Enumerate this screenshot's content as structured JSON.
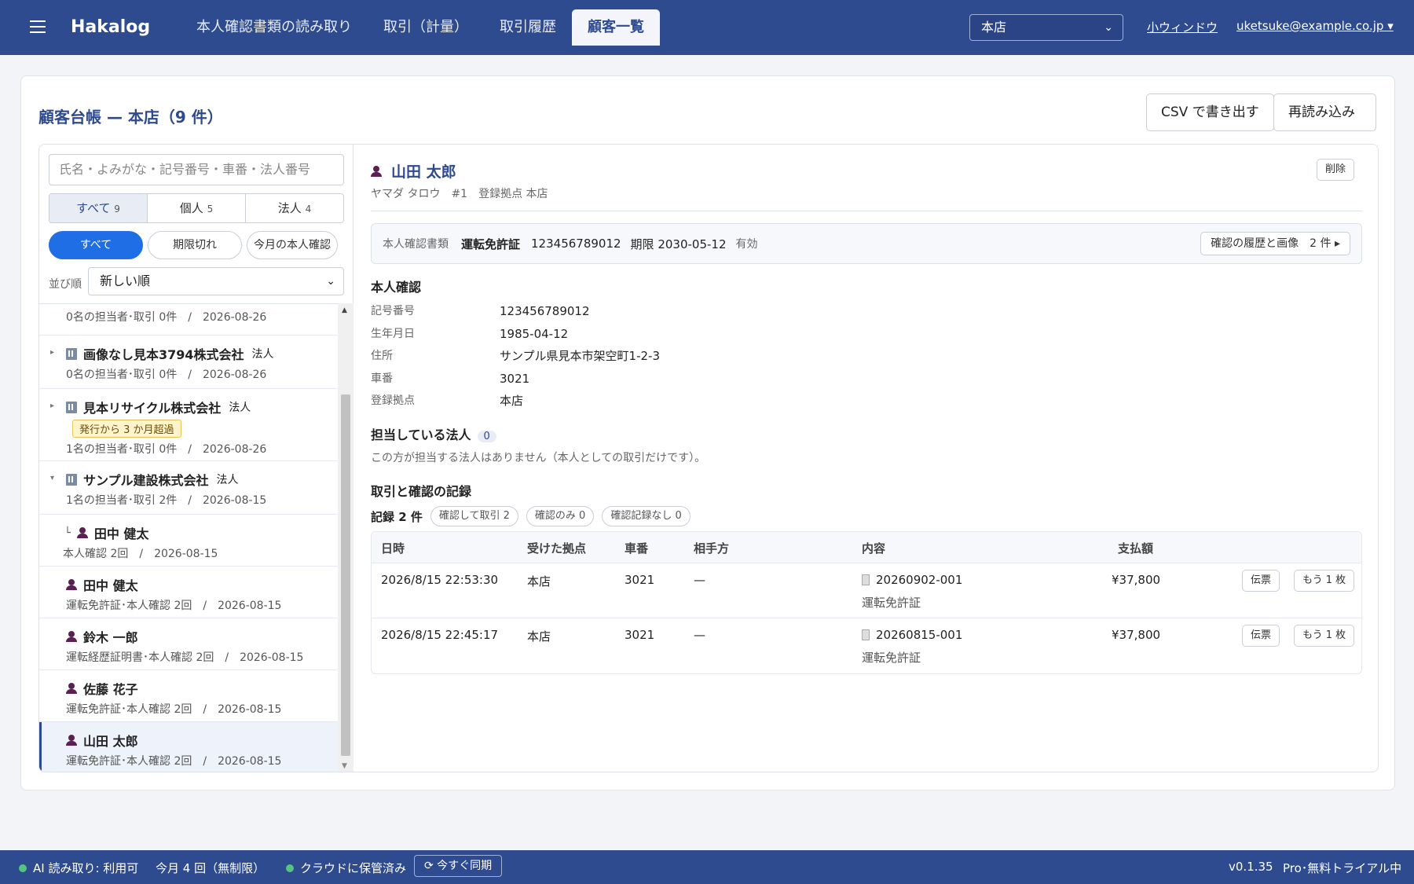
{
  "header": {
    "brand": "Hakalog",
    "tabs": [
      "本人確認書類の読み取り",
      "取引（計量）",
      "取引履歴",
      "顧客一覧"
    ],
    "active_tab": "顧客一覧",
    "branch": "本店",
    "small_window": "小ウィンドウ",
    "user": "uketsuke@example.co.jp ▾"
  },
  "card": {
    "title": "顧客台帳 — 本店（9 件）",
    "export_csv": "CSV で書き出す",
    "reload": "再読み込み"
  },
  "sidebar": {
    "search_placeholder": "氏名・よみがな・記号番号・車番・法人番号",
    "segments": [
      {
        "label": "すべて",
        "count": "9"
      },
      {
        "label": "個人",
        "count": "5"
      },
      {
        "label": "法人",
        "count": "4"
      }
    ],
    "filters": [
      "すべて",
      "期限切れ",
      "今月の本人確認"
    ],
    "sort_label": "並び順",
    "sort_value": "新しい順",
    "items": [
      {
        "kind": "partial",
        "name": "",
        "tag": "",
        "meta": "0名の担当者･取引 0件　/　2026-08-26"
      },
      {
        "kind": "corp",
        "name": "画像なし見本3794株式会社",
        "tag": "法人",
        "meta": "0名の担当者･取引 0件　/　2026-08-26"
      },
      {
        "kind": "corp",
        "name": "見本リサイクル株式会社",
        "tag": "法人",
        "badge": "発行から 3 か月超過",
        "meta": "1名の担当者･取引 0件　/　2026-08-26"
      },
      {
        "kind": "corp-open",
        "name": "サンプル建設株式会社",
        "tag": "法人",
        "meta": "1名の担当者･取引 2件　/　2026-08-15"
      },
      {
        "kind": "child",
        "name": "田中 健太",
        "meta": "本人確認 2回　/　2026-08-15"
      },
      {
        "kind": "person",
        "name": "田中 健太",
        "meta": "運転免許証･本人確認 2回　/　2026-08-15"
      },
      {
        "kind": "person",
        "name": "鈴木 一郎",
        "meta": "運転経歴証明書･本人確認 2回　/　2026-08-15"
      },
      {
        "kind": "person",
        "name": "佐藤 花子",
        "meta": "運転免許証･本人確認 2回　/　2026-08-15"
      },
      {
        "kind": "person-selected",
        "name": "山田 太郎",
        "meta": "運転免許証･本人確認 2回　/　2026-08-15"
      }
    ]
  },
  "detail": {
    "name": "山田 太郎",
    "sub": "ヤマダ タロウ　#1　登録拠点 本店",
    "delete": "削除",
    "id_label": "本人確認書類",
    "id_doc": "運転免許証",
    "id_number": "123456789012",
    "id_expiry": "期限 2030-05-12",
    "id_status": "有効",
    "history_btn": "確認の履歴と画像　2 件 ▸",
    "identity_title": "本人確認",
    "fields": [
      {
        "k": "記号番号",
        "v": "123456789012"
      },
      {
        "k": "生年月日",
        "v": "1985-04-12"
      },
      {
        "k": "住所",
        "v": "サンプル県見本市架空町1-2-3"
      },
      {
        "k": "車番",
        "v": "3021"
      },
      {
        "k": "登録拠点",
        "v": "本店"
      }
    ],
    "corp_title": "担当している法人",
    "corp_count": "0",
    "corp_note": "この方が担当する法人はありません（本人としての取引だけです）。",
    "records_title": "取引と確認の記録",
    "records_total": "記録 2 件",
    "chips": [
      "確認して取引 2",
      "確認のみ 0",
      "確認記録なし 0"
    ],
    "columns": [
      "日時",
      "受けた拠点",
      "車番",
      "相手方",
      "内容",
      "支払額"
    ],
    "rows": [
      {
        "datetime": "2026/8/15 22:53:30",
        "branch": "本店",
        "plate": "3021",
        "partner": "—",
        "slip": "20260902-001",
        "doc": "運転免許証",
        "amount": "¥37,800",
        "btn1": "伝票",
        "btn2": "もう 1 枚"
      },
      {
        "datetime": "2026/8/15 22:45:17",
        "branch": "本店",
        "plate": "3021",
        "partner": "—",
        "slip": "20260815-001",
        "doc": "運転免許証",
        "amount": "¥37,800",
        "btn1": "伝票",
        "btn2": "もう 1 枚"
      }
    ]
  },
  "status": {
    "ai": "AI 読み取り: 利用可",
    "month": "今月 4 回（無制限）",
    "cloud": "クラウドに保管済み",
    "sync": "⟳ 今すぐ同期",
    "version": "v0.1.35",
    "plan": "Pro･無料トライアル中"
  }
}
